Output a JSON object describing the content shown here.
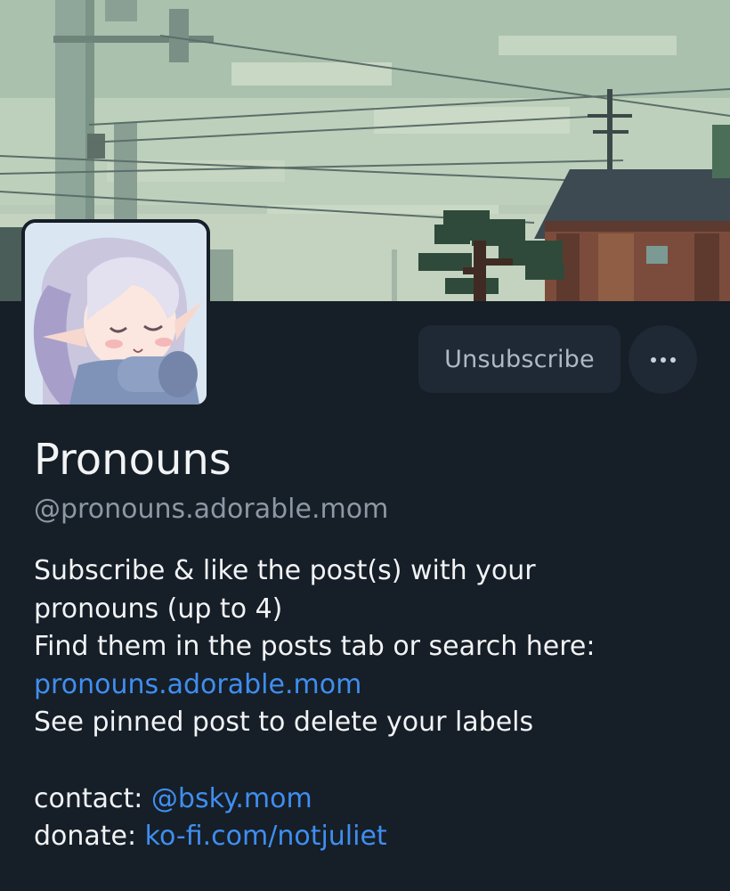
{
  "profile": {
    "display_name": "Pronouns",
    "handle": "@pronouns.adorable.mom",
    "banner_icon": "pixel-art-street-scene-image",
    "avatar_icon": "anime-elf-girl-avatar-image"
  },
  "actions": {
    "unsubscribe_label": "Unsubscribe",
    "more_icon": "more-horizontal-icon"
  },
  "bio": {
    "line1": "Subscribe & like the post(s) with your",
    "line2": "pronouns (up to 4)",
    "line3": "Find them in the posts tab or search here:",
    "link_site": "pronouns.adorable.mom",
    "line5": "See pinned post to delete your labels",
    "contact_label": "contact: ",
    "contact_link": "@bsky.mom",
    "donate_label": "donate: ",
    "donate_link": "ko-fi.com/notjuliet"
  },
  "colors": {
    "background": "#161e27",
    "button_bg": "#1e2935",
    "link": "#3f8ef0",
    "text": "#f1f3f5",
    "muted": "#8d98a5"
  }
}
